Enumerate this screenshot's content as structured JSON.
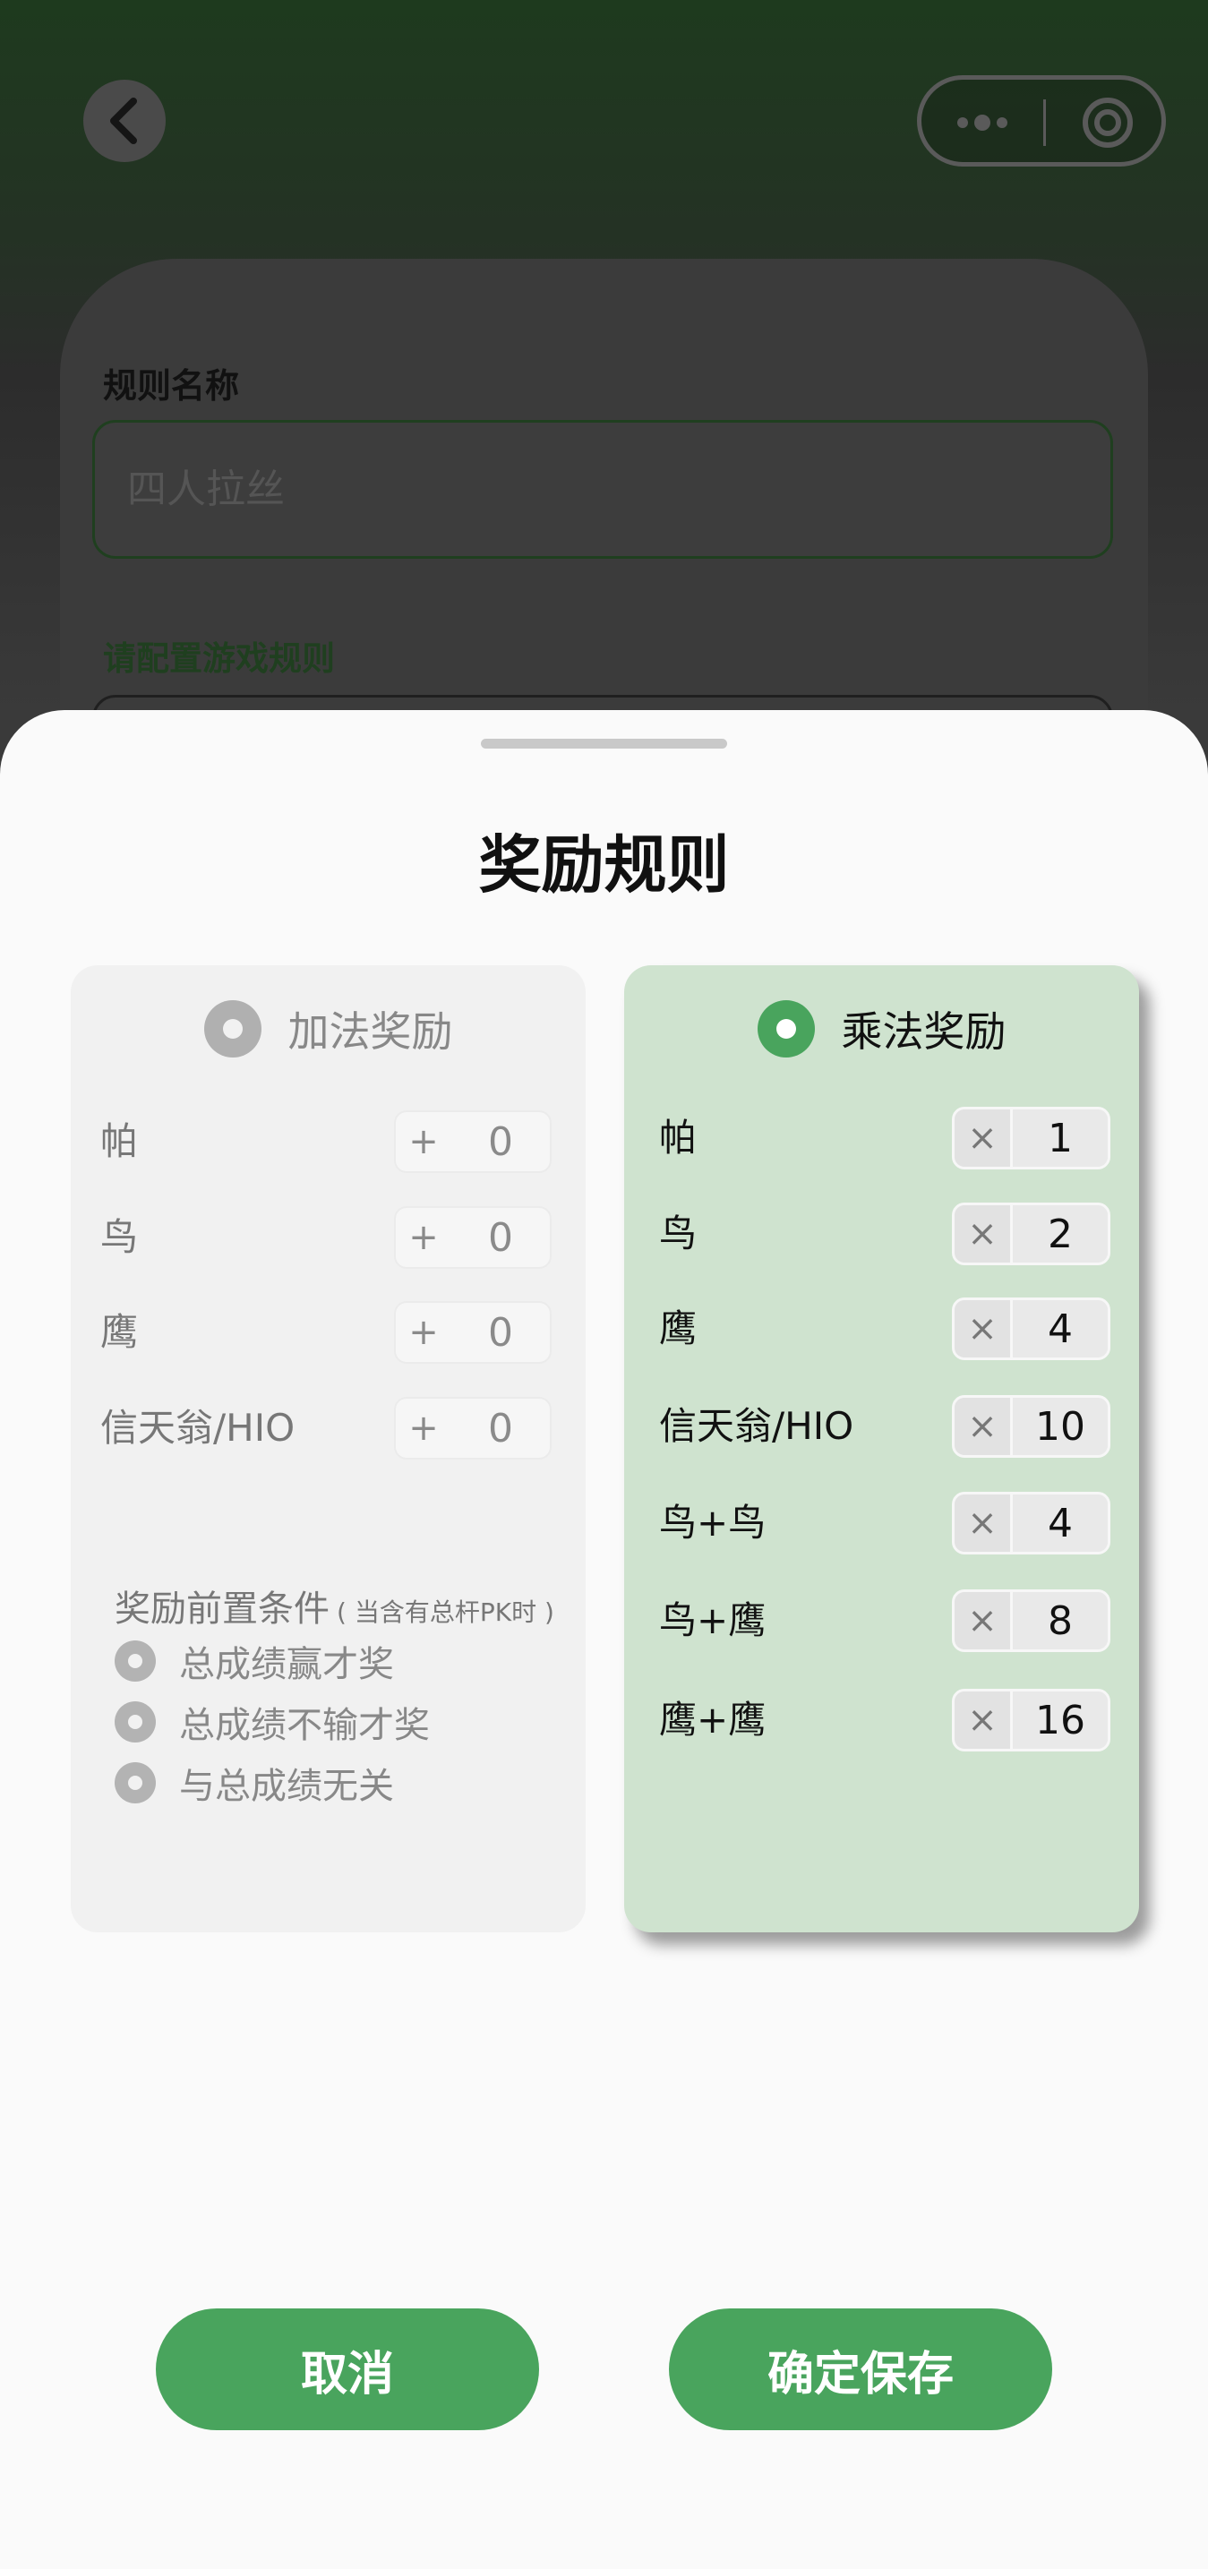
{
  "background_page": {
    "rule_name_label": "规则名称",
    "rule_name_placeholder": "四人拉丝",
    "config_label": "请配置游戏规则"
  },
  "sheet": {
    "title": "奖励规则",
    "additive": {
      "title": "加法奖励",
      "selected": false,
      "op": "+",
      "rows": [
        {
          "label": "帕",
          "value": "0"
        },
        {
          "label": "鸟",
          "value": "0"
        },
        {
          "label": "鹰",
          "value": "0"
        },
        {
          "label": "信天翁/HIO",
          "value": "0"
        }
      ],
      "precondition": {
        "title": "奖励前置条件",
        "note": "( 当含有总杆PK时 )",
        "options": [
          "总成绩赢才奖",
          "总成绩不输才奖",
          "与总成绩无关"
        ]
      }
    },
    "multiplicative": {
      "title": "乘法奖励",
      "selected": true,
      "op": "×",
      "rows": [
        {
          "label": "帕",
          "value": "1"
        },
        {
          "label": "鸟",
          "value": "2"
        },
        {
          "label": "鹰",
          "value": "4"
        },
        {
          "label": "信天翁/HIO",
          "value": "10"
        },
        {
          "label": "鸟+鸟",
          "value": "4"
        },
        {
          "label": "鸟+鹰",
          "value": "8"
        },
        {
          "label": "鹰+鹰",
          "value": "16"
        }
      ]
    },
    "buttons": {
      "cancel": "取消",
      "save": "确定保存"
    }
  },
  "colors": {
    "accent": "#49a45d",
    "selected_panel": "#cfe3cf",
    "unselected_panel": "#f1f1f1"
  }
}
